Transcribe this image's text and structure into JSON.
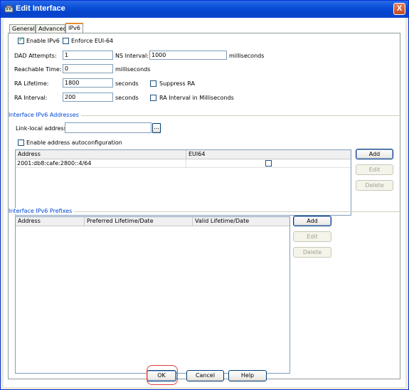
{
  "window": {
    "title": "Edit Interface",
    "close": "X"
  },
  "tabs": [
    {
      "label": "General"
    },
    {
      "label": "Advanced"
    },
    {
      "label": "IPv6"
    }
  ],
  "ipv6": {
    "enable_ipv6": {
      "label": "Enable IPv6",
      "checked": true
    },
    "enforce_eui64": {
      "label": "Enforce EUI-64",
      "checked": false
    },
    "dad_attempts": {
      "label": "DAD Attempts:",
      "value": "1"
    },
    "ns_interval": {
      "label": "NS Interval:",
      "value": "1000",
      "unit": "milliseconds"
    },
    "reachable_time": {
      "label": "Reachable Time:",
      "value": "0",
      "unit": "milliseconds"
    },
    "ra_lifetime": {
      "label": "RA Lifetime:",
      "value": "1800",
      "unit": "seconds"
    },
    "suppress_ra": {
      "label": "Suppress RA",
      "checked": false
    },
    "ra_interval": {
      "label": "RA Interval:",
      "value": "200",
      "unit": "seconds"
    },
    "ra_interval_ms": {
      "label": "RA Interval in Milliseconds",
      "checked": false
    }
  },
  "addresses": {
    "group_title": "Interface IPv6 Addresses",
    "link_local_label": "Link-local address:",
    "link_local_value": "",
    "browse_label": "...",
    "autoconfig": {
      "label": "Enable address autoconfiguration",
      "checked": false
    },
    "columns": [
      "Address",
      "EUI64"
    ],
    "rows": [
      {
        "address": "2001:db8:cafe:2800::4/64",
        "eui64": false
      }
    ],
    "buttons": {
      "add": "Add",
      "edit": "Edit",
      "delete": "Delete"
    }
  },
  "prefixes": {
    "group_title": "Interface IPv6 Prefixes",
    "columns": [
      "Address",
      "Preferred Lifetime/Date",
      "Valid Lifetime/Date"
    ],
    "buttons": {
      "add": "Add",
      "edit": "Edit",
      "delete": "Delete"
    }
  },
  "footer": {
    "ok": "OK",
    "cancel": "Cancel",
    "help": "Help"
  },
  "colors": {
    "titlebar": "#0a4fd8",
    "highlight": "#e23c3c",
    "group_title": "#0046d5"
  }
}
